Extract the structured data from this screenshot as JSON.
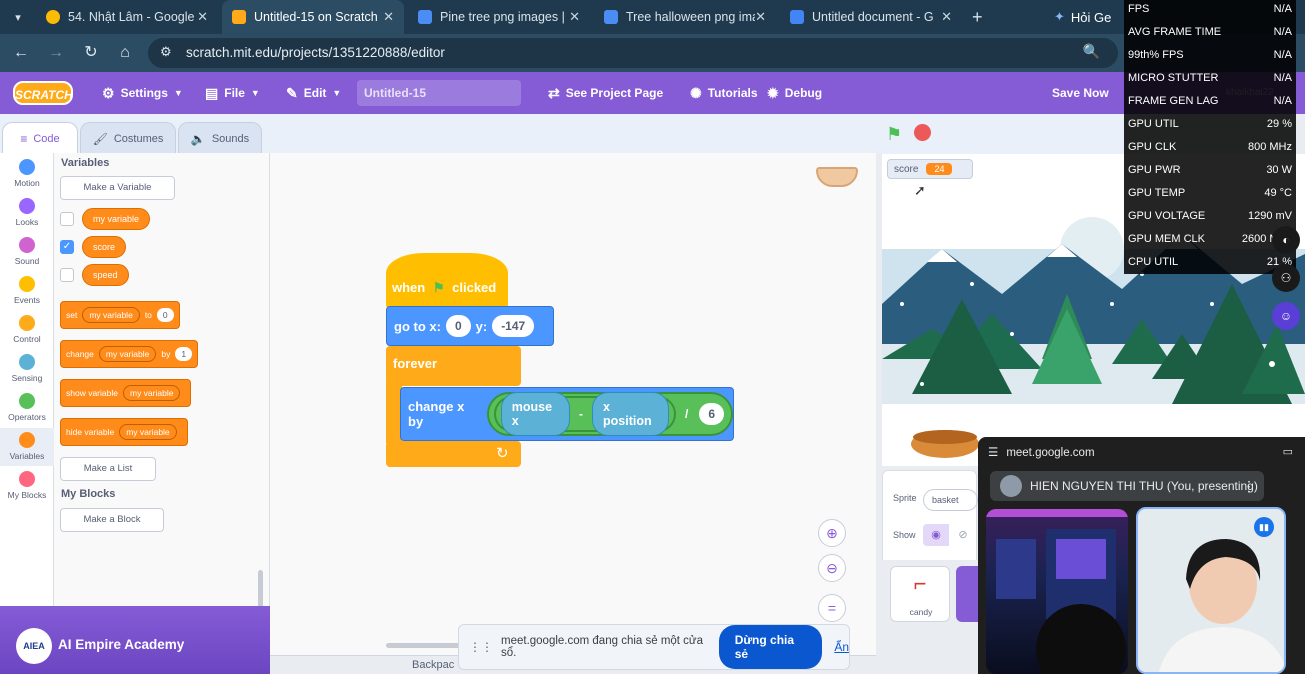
{
  "browser": {
    "tabs": [
      {
        "title": "54. Nhật Lâm - Google",
        "icon_color": "#fbbc05",
        "icon": "google-icon"
      },
      {
        "title": "Untitled-15 on Scratch",
        "icon_color": "#ffab19",
        "icon": "scratch-icon",
        "active": true
      },
      {
        "title": "Pine tree png images |",
        "icon_color": "#4c8cf5",
        "icon": "site-icon"
      },
      {
        "title": "Tree halloween png ima",
        "icon_color": "#4c8cf5",
        "icon": "site-icon"
      },
      {
        "title": "Untitled document - G",
        "icon_color": "#4285f4",
        "icon": "docs-icon"
      }
    ],
    "gemini_label": "Hỏi Ge",
    "url": "scratch.mit.edu/projects/1351220888/editor"
  },
  "scratch_menu": {
    "logo": "SCRATCH",
    "settings": "Settings",
    "file": "File",
    "edit": "Edit",
    "project_title": "Untitled-15",
    "see_project": "See Project Page",
    "tutorials": "Tutorials",
    "debug": "Debug",
    "save_now": "Save Now",
    "username": "khaikhai22"
  },
  "editor_tabs": {
    "code": "Code",
    "costumes": "Costumes",
    "sounds": "Sounds"
  },
  "categories": [
    {
      "label": "Motion",
      "color": "#4c97ff"
    },
    {
      "label": "Looks",
      "color": "#9966ff"
    },
    {
      "label": "Sound",
      "color": "#cf63cf"
    },
    {
      "label": "Events",
      "color": "#ffbf00"
    },
    {
      "label": "Control",
      "color": "#ffab19"
    },
    {
      "label": "Sensing",
      "color": "#5cb1d6"
    },
    {
      "label": "Operators",
      "color": "#59c059"
    },
    {
      "label": "Variables",
      "color": "#ff8c1a"
    },
    {
      "label": "My Blocks",
      "color": "#ff6680"
    }
  ],
  "palette": {
    "heading": "Variables",
    "make_variable": "Make a Variable",
    "variables": [
      {
        "name": "my variable",
        "checked": false
      },
      {
        "name": "score",
        "checked": true
      },
      {
        "name": "speed",
        "checked": false
      }
    ],
    "set_block": {
      "label": "set",
      "var": "my variable",
      "to": "to",
      "value": "0"
    },
    "change_block": {
      "label": "change",
      "var": "my variable",
      "by": "by",
      "value": "1"
    },
    "show_block": {
      "label": "show variable",
      "var": "my variable"
    },
    "hide_block": {
      "label": "hide variable",
      "var": "my variable"
    },
    "make_list": "Make a List",
    "my_blocks_heading": "My Blocks",
    "make_block": "Make a Block"
  },
  "script": {
    "hat": {
      "when": "when",
      "clicked": "clicked"
    },
    "goto": {
      "label": "go to x:",
      "x": "0",
      "ylabel": "y:",
      "y": "-147"
    },
    "forever": "forever",
    "change_x": {
      "label": "change x by",
      "mouse_x": "mouse x",
      "minus": "-",
      "x_position": "x position",
      "divide": "/",
      "divisor": "6"
    }
  },
  "stage": {
    "monitor_label": "score",
    "monitor_value": "24"
  },
  "sprite_pane": {
    "sprite_label": "Sprite",
    "sprite_name": "basket",
    "show_label": "Show",
    "thumb_label": "candy"
  },
  "backpack": "Backpac",
  "share_banner": {
    "text": "meet.google.com đang chia sẻ một cửa sổ.",
    "stop": "Dừng chia sẻ",
    "hide": "Ẩn"
  },
  "watermark": "AI Empire Academy",
  "watermark_logo": "AIEA",
  "perf": [
    {
      "k": "FPS",
      "v": "N/A"
    },
    {
      "k": "AVG FRAME TIME",
      "v": "N/A"
    },
    {
      "k": "99th% FPS",
      "v": "N/A"
    },
    {
      "k": "MICRO STUTTER",
      "v": "N/A"
    },
    {
      "k": "FRAME GEN LAG",
      "v": "N/A"
    },
    {
      "k": "GPU UTIL",
      "v": "29 %"
    },
    {
      "k": "GPU CLK",
      "v": "800 MHz"
    },
    {
      "k": "GPU PWR",
      "v": "30 W"
    },
    {
      "k": "GPU TEMP",
      "v": "49 °C"
    },
    {
      "k": "GPU VOLTAGE",
      "v": "1290 mV"
    },
    {
      "k": "GPU MEM CLK",
      "v": "2600 MHz"
    },
    {
      "k": "CPU UTIL",
      "v": "21 %"
    }
  ],
  "meet": {
    "host": "meet.google.com",
    "presenter": "HIEN NGUYEN THI THU (You, presenting)"
  }
}
